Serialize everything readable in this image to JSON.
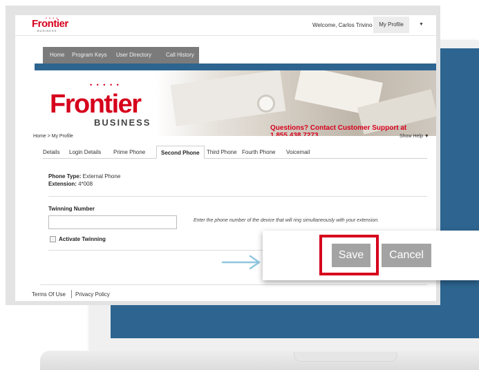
{
  "header": {
    "brand": "Frontier",
    "brand_sub": "BUSINESS",
    "welcome": "Welcome, Carlos Trivino",
    "my_profile": "My Profile"
  },
  "nav": {
    "items": [
      {
        "label": "Home"
      },
      {
        "label": "Program Keys"
      },
      {
        "label": "User Directory"
      },
      {
        "label": "Call History"
      }
    ]
  },
  "banner": {
    "brand": "Frontier",
    "brand_sub": "BUSINESS",
    "support": "Questions? Contact Customer Support at 1.855.438.7273"
  },
  "breadcrumb": "Home > My Profile",
  "show_help": "Show Help",
  "tabs": [
    {
      "label": "Details"
    },
    {
      "label": "Login Details"
    },
    {
      "label": "Prime Phone"
    },
    {
      "label": "Second Phone",
      "active": true
    },
    {
      "label": "Third Phone"
    },
    {
      "label": "Fourth Phone"
    },
    {
      "label": "Voicemail"
    }
  ],
  "phone": {
    "type_label": "Phone Type:",
    "type_value": "External Phone",
    "ext_label": "Extension:",
    "ext_value": "4*008"
  },
  "twinning": {
    "label": "Twinning Number",
    "value": "",
    "help": "Enter the phone number of the device that will ring simultaneously with your extension.",
    "activate_label": "Activate Twinning",
    "activate_checked": false
  },
  "actions": {
    "save": "Save",
    "cancel": "Cancel"
  },
  "footer": {
    "terms": "Terms Of Use",
    "privacy": "Privacy Policy"
  },
  "colors": {
    "brand_red": "#d6001c",
    "nav_gray": "#7b7b7b",
    "accent_blue": "#2d6590",
    "button_gray": "#a3a3a3"
  }
}
